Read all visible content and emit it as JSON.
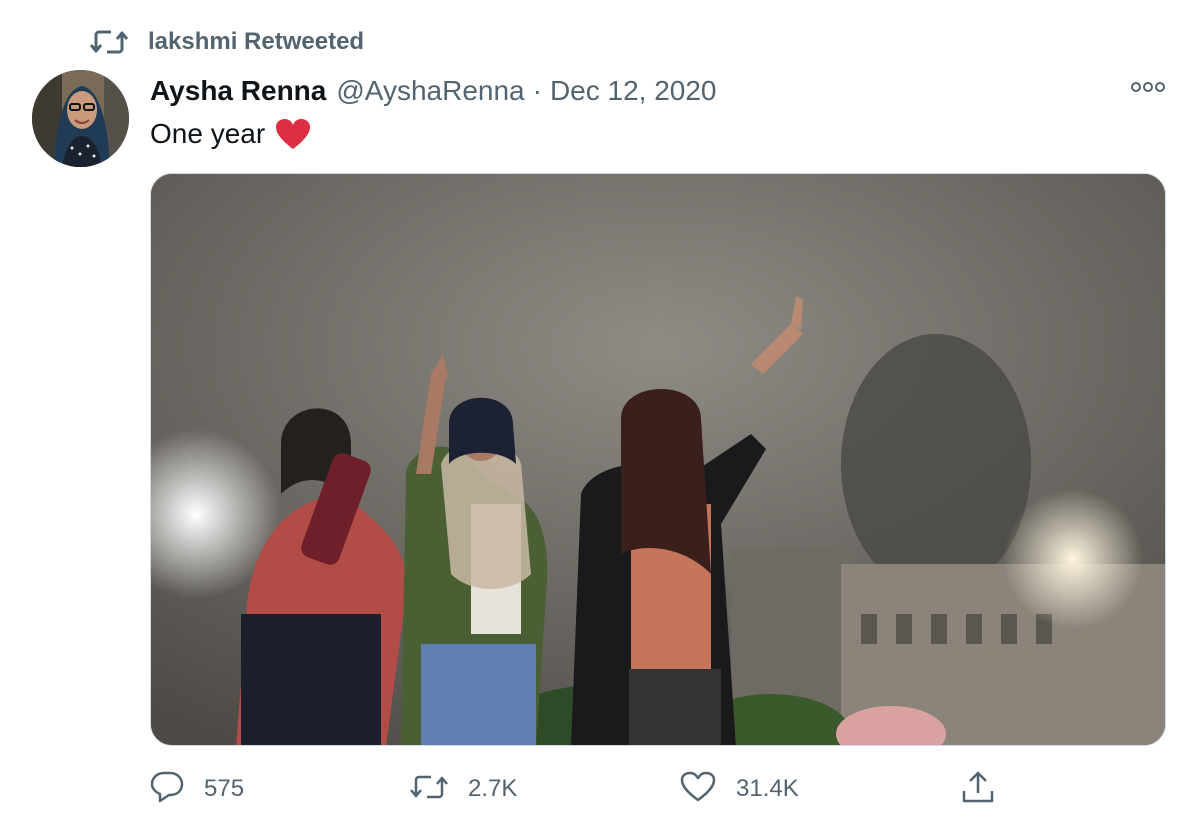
{
  "social_context": {
    "text": "lakshmi Retweeted",
    "icon": "retweet-icon"
  },
  "tweet": {
    "author_name": "Aysha Renna",
    "author_handle": "@AyshaRenna",
    "separator": "·",
    "date": "Dec 12, 2020",
    "text": "One year",
    "emoji": "red-heart-emoji",
    "media_description_icon": "photo"
  },
  "actions": {
    "reply": {
      "icon": "reply-icon",
      "count": "575"
    },
    "retweet": {
      "icon": "retweet-icon",
      "count": "2.7K"
    },
    "like": {
      "icon": "like-icon",
      "count": "31.4K"
    },
    "share": {
      "icon": "share-icon"
    }
  },
  "colors": {
    "primary_text": "#0f1419",
    "secondary_text": "#536471",
    "border": "#cfd9de",
    "heart": "#e0245e"
  }
}
